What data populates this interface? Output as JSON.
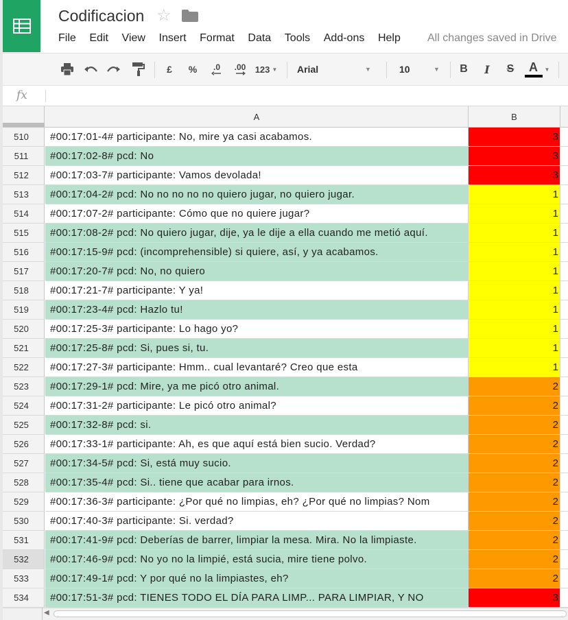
{
  "app": {
    "title": "Codificacion",
    "saved_status": "All changes saved in Drive"
  },
  "menu": [
    "File",
    "Edit",
    "View",
    "Insert",
    "Format",
    "Data",
    "Tools",
    "Add-ons",
    "Help"
  ],
  "toolbar": {
    "currency": "£",
    "percent": "%",
    "decrease_decimals": ".0",
    "increase_decimals": ".00",
    "more_formats": "123",
    "font": "Arial",
    "font_size": "10",
    "bold": "B",
    "italic": "I",
    "strikethrough": "S",
    "text_color": "A"
  },
  "formula_bar": {
    "label": "fx",
    "value": ""
  },
  "columns": [
    "A",
    "B"
  ],
  "colors": {
    "green_fill": "#b7e1cd",
    "red_fill": "#ff0000",
    "yellow_fill": "#ffff00",
    "orange_fill": "#ff9900",
    "brand": "#1fa463"
  },
  "rows": [
    {
      "num": "510",
      "a": "#00:17:01-4# participante: No, mire ya casi acabamos.",
      "b": "3",
      "a_fill": "#ffffff",
      "b_fill": "#ff0000"
    },
    {
      "num": "511",
      "a": "#00:17:02-8# pcd: No",
      "b": "3",
      "a_fill": "#b7e1cd",
      "b_fill": "#ff0000"
    },
    {
      "num": "512",
      "a": "#00:17:03-7# participante: Vamos devolada!",
      "b": "3",
      "a_fill": "#ffffff",
      "b_fill": "#ff0000"
    },
    {
      "num": "513",
      "a": "#00:17:04-2# pcd: No no no no no quiero jugar, no quiero jugar.",
      "b": "1",
      "a_fill": "#b7e1cd",
      "b_fill": "#ffff00"
    },
    {
      "num": "514",
      "a": "#00:17:07-2# participante: Cómo que no quiere jugar?",
      "b": "1",
      "a_fill": "#ffffff",
      "b_fill": "#ffff00"
    },
    {
      "num": "515",
      "a": "#00:17:08-2# pcd: No quiero jugar, dije, ya le dije a ella cuando me metió aquí.",
      "b": "1",
      "a_fill": "#b7e1cd",
      "b_fill": "#ffff00"
    },
    {
      "num": "516",
      "a": "#00:17:15-9# pcd: (incomprehensible) si quiere, así, y ya acabamos.",
      "b": "1",
      "a_fill": "#b7e1cd",
      "b_fill": "#ffff00"
    },
    {
      "num": "517",
      "a": "#00:17:20-7# pcd: No, no quiero",
      "b": "1",
      "a_fill": "#b7e1cd",
      "b_fill": "#ffff00"
    },
    {
      "num": "518",
      "a": "#00:17:21-7# participante: Y ya!",
      "b": "1",
      "a_fill": "#ffffff",
      "b_fill": "#ffff00"
    },
    {
      "num": "519",
      "a": "#00:17:23-4# pcd: Hazlo tu!",
      "b": "1",
      "a_fill": "#b7e1cd",
      "b_fill": "#ffff00"
    },
    {
      "num": "520",
      "a": "#00:17:25-3# participante: Lo hago yo?",
      "b": "1",
      "a_fill": "#ffffff",
      "b_fill": "#ffff00"
    },
    {
      "num": "521",
      "a": "#00:17:25-8# pcd: Si, pues si, tu.",
      "b": "1",
      "a_fill": "#b7e1cd",
      "b_fill": "#ffff00"
    },
    {
      "num": "522",
      "a": "#00:17:27-3# participante: Hmm.. cual levantaré? Creo que esta",
      "b": "1",
      "a_fill": "#ffffff",
      "b_fill": "#ffff00"
    },
    {
      "num": "523",
      "a": "#00:17:29-1# pcd: Mire, ya me picó otro animal.",
      "b": "2",
      "a_fill": "#b7e1cd",
      "b_fill": "#ff9900"
    },
    {
      "num": "524",
      "a": "#00:17:31-2# participante: Le picó otro animal?",
      "b": "2",
      "a_fill": "#ffffff",
      "b_fill": "#ff9900"
    },
    {
      "num": "525",
      "a": "#00:17:32-8# pcd: si.",
      "b": "2",
      "a_fill": "#b7e1cd",
      "b_fill": "#ff9900"
    },
    {
      "num": "526",
      "a": "#00:17:33-1# participante: Ah, es que aquí está bien sucio. Verdad?",
      "b": "2",
      "a_fill": "#ffffff",
      "b_fill": "#ff9900"
    },
    {
      "num": "527",
      "a": "#00:17:34-5# pcd: Si, está muy sucio.",
      "b": "2",
      "a_fill": "#b7e1cd",
      "b_fill": "#ff9900"
    },
    {
      "num": "528",
      "a": "#00:17:35-4# pcd: Si.. tiene que acabar para irnos.",
      "b": "2",
      "a_fill": "#b7e1cd",
      "b_fill": "#ff9900"
    },
    {
      "num": "529",
      "a": "#00:17:36-3# participante: ¿Por qué no limpias, eh? ¿Por qué no limpias? Nom",
      "b": "2",
      "a_fill": "#ffffff",
      "b_fill": "#ff9900"
    },
    {
      "num": "530",
      "a": "#00:17:40-3# participante:  Si. verdad?",
      "b": "2",
      "a_fill": "#ffffff",
      "b_fill": "#ff9900"
    },
    {
      "num": "531",
      "a": "#00:17:41-9# pcd: Deberías de barrer, limpiar la mesa. Mira. No la limpiaste.",
      "b": "2",
      "a_fill": "#b7e1cd",
      "b_fill": "#ff9900"
    },
    {
      "num": "532",
      "a": "#00:17:46-9# pcd: No yo no la limpié, está sucia, mire tiene polvo.",
      "b": "2",
      "a_fill": "#b7e1cd",
      "b_fill": "#ff9900",
      "selected": true
    },
    {
      "num": "533",
      "a": "#00:17:49-1# pcd: Y por qué no la limpiastes, eh?",
      "b": "2",
      "a_fill": "#b7e1cd",
      "b_fill": "#ff9900"
    },
    {
      "num": "534",
      "a": "#00:17:51-3# pcd: TIENES TODO EL DÍA PARA LIMP... PARA LIMPIAR, Y NO",
      "b": "3",
      "a_fill": "#b7e1cd",
      "b_fill": "#ff0000"
    }
  ]
}
